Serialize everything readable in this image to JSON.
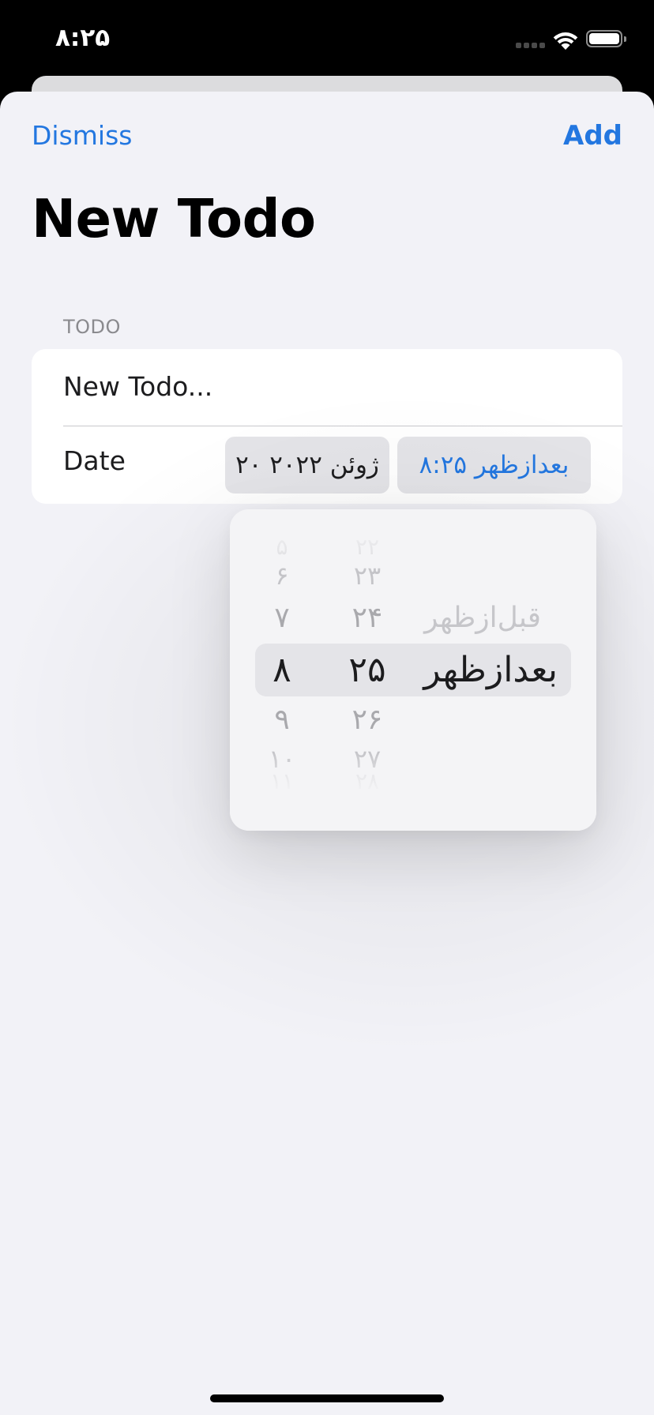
{
  "status_bar": {
    "time": "۸:۲۵",
    "icons": [
      "cellular-signal-icon",
      "wifi-icon",
      "battery-icon"
    ]
  },
  "nav": {
    "dismiss_label": "Dismiss",
    "add_label": "Add"
  },
  "title": "New Todo",
  "section": {
    "header": "TODO"
  },
  "form": {
    "todo_placeholder": "New Todo...",
    "date_label": "Date",
    "date_value": "۲۰ ژوئن ۲۰۲۲",
    "time_value": "۸:۲۵ بعدازظهر"
  },
  "time_picker": {
    "hours": {
      "up3": "۵",
      "up2": "۶",
      "up1": "۷",
      "selected": "۸",
      "dn1": "۹",
      "dn2": "۱۰",
      "dn3": "۱۱"
    },
    "minutes": {
      "up3": "۲۲",
      "up2": "۲۳",
      "up1": "۲۴",
      "selected": "۲۵",
      "dn1": "۲۶",
      "dn2": "۲۷",
      "dn3": "۲۸"
    },
    "period": {
      "other": "قبل‌ازظهر",
      "selected": "بعدازظهر"
    }
  },
  "colors": {
    "accent": "#2377e0",
    "background": "#f2f2f7",
    "card": "#ffffff",
    "pill": "#e4e4e8"
  }
}
